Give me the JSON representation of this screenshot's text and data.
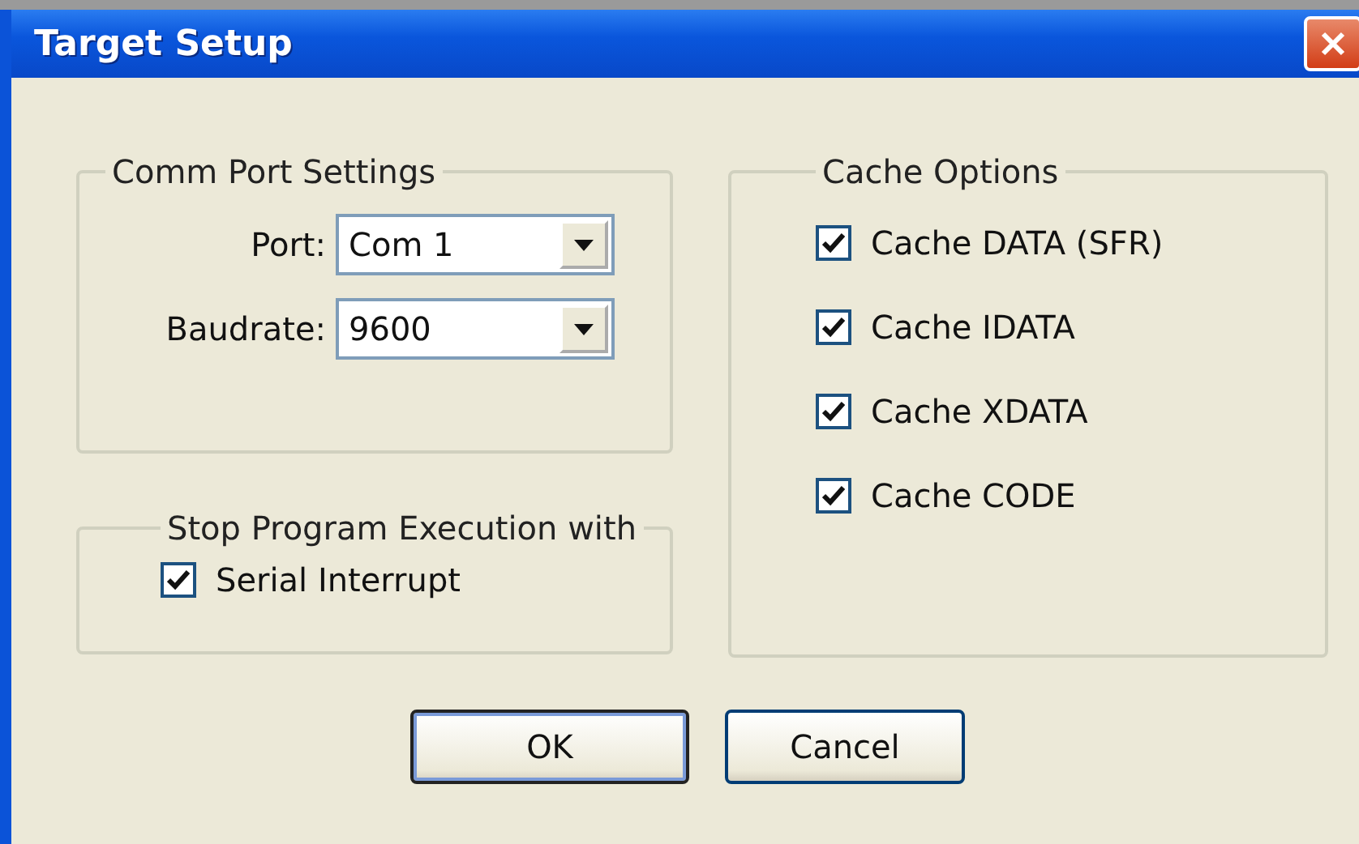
{
  "window": {
    "title": "Target Setup"
  },
  "comm_port_settings": {
    "title": "Comm Port Settings",
    "fields": [
      {
        "label": "Port:",
        "value": "Com 1"
      },
      {
        "label": "Baudrate:",
        "value": "9600"
      }
    ]
  },
  "stop_program_execution": {
    "title": "Stop Program Execution with",
    "options": [
      {
        "label": "Serial Interrupt",
        "checked": true
      }
    ]
  },
  "cache_options": {
    "title": "Cache Options",
    "options": [
      {
        "label": "Cache DATA (SFR)",
        "checked": true
      },
      {
        "label": "Cache IDATA",
        "checked": true
      },
      {
        "label": "Cache XDATA",
        "checked": true
      },
      {
        "label": "Cache CODE",
        "checked": true
      }
    ]
  },
  "buttons": [
    {
      "label": "OK",
      "default": true
    },
    {
      "label": "Cancel",
      "default": false
    }
  ]
}
